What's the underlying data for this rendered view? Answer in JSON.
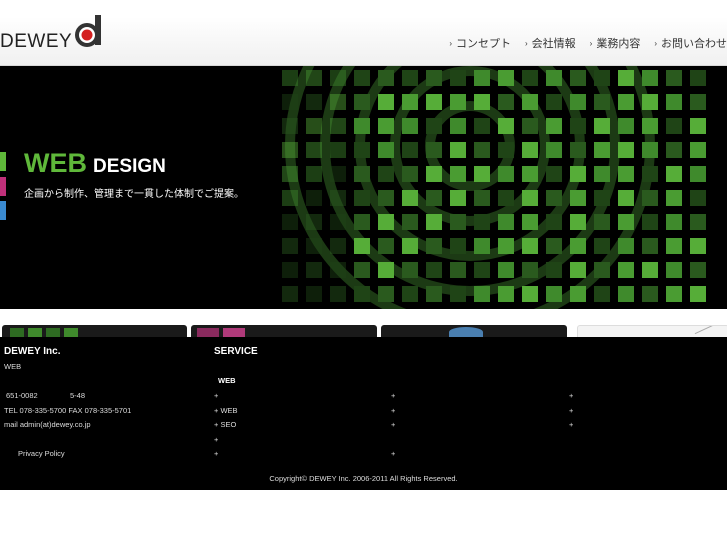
{
  "header": {
    "logo_text": "DEWEY",
    "nav": [
      "コンセプト",
      "会社情報",
      "業務内容",
      "お問い合わせ"
    ]
  },
  "hero": {
    "title_main": "WEB",
    "title_sub": "DESIGN",
    "tagline": "企画から制作、管理まで一貫した体制でご提案。",
    "colors": {
      "bar1": "#5fb83a",
      "bar2": "#c0307a",
      "bar3": "#3a8ad0"
    }
  },
  "footer": {
    "company": {
      "name": "DEWEY Inc.",
      "tag": "WEB",
      "postal": "651-0082",
      "address": "5-48",
      "tel_fax": "TEL 078-335-5700 FAX 078-335-5701",
      "mail": "mail admin(at)dewey.co.jp",
      "privacy": "Privacy Policy"
    },
    "service": {
      "heading": "SERVICE",
      "subheading": "WEB",
      "col1": [
        "+",
        "+ WEB",
        "+ SEO",
        "+",
        "+"
      ],
      "col2": [
        "+",
        "+",
        "+",
        "+"
      ],
      "col3": [
        "+",
        "+",
        "+"
      ]
    },
    "copyright": "Copyright© DEWEY Inc. 2006-2011 All Rights Reserved."
  }
}
